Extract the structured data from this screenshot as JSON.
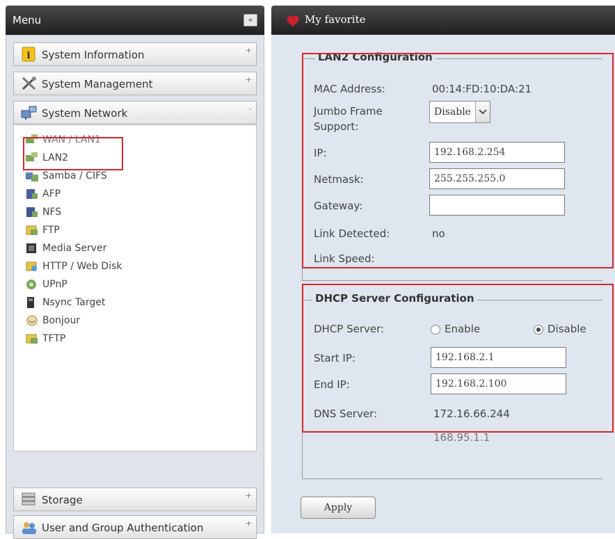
{
  "menu": {
    "title": "Menu",
    "collapse_glyph": "«",
    "categories": [
      {
        "label": "System Information",
        "icon": "info-icon",
        "toggle": "+"
      },
      {
        "label": "System Management",
        "icon": "tools-icon",
        "toggle": "+"
      },
      {
        "label": "System Network",
        "icon": "network-icon",
        "toggle": "-"
      }
    ],
    "network_items": [
      {
        "label": "WAN / LAN1"
      },
      {
        "label": "LAN2"
      },
      {
        "label": "Samba / CIFS"
      },
      {
        "label": "AFP"
      },
      {
        "label": "NFS"
      },
      {
        "label": "FTP"
      },
      {
        "label": "Media Server"
      },
      {
        "label": "HTTP / Web Disk"
      },
      {
        "label": "UPnP"
      },
      {
        "label": "Nsync Target"
      },
      {
        "label": "Bonjour"
      },
      {
        "label": "TFTP"
      }
    ],
    "bottom_categories": [
      {
        "label": "Storage",
        "icon": "storage-icon",
        "toggle": "+"
      },
      {
        "label": "User and Group Authentication",
        "icon": "users-icon",
        "toggle": "+"
      }
    ]
  },
  "favorite": {
    "title": "My favorite",
    "icon": "heart-icon"
  },
  "lan2": {
    "legend": "LAN2 Configuration",
    "mac_label": "MAC Address:",
    "mac_value": "00:14:FD:10:DA:21",
    "jumbo_label_1": "Jumbo Frame",
    "jumbo_label_2": "Support:",
    "jumbo_value": "Disable",
    "ip_label": "IP:",
    "ip_value": "192.168.2.254",
    "netmask_label": "Netmask:",
    "netmask_value": "255.255.255.0",
    "gateway_label": "Gateway:",
    "gateway_value": "",
    "link_detected_label": "Link Detected:",
    "link_detected_value": "no",
    "link_speed_label": "Link Speed:",
    "link_speed_value": ""
  },
  "dhcp": {
    "legend": "DHCP Server Configuration",
    "server_label": "DHCP Server:",
    "enable_label": "Enable",
    "disable_label": "Disable",
    "selected": "Disable",
    "start_label": "Start IP:",
    "start_value": "192.168.2.1",
    "end_label": "End IP:",
    "end_value": "192.168.2.100",
    "dns_label": "DNS Server:",
    "dns_values": [
      "172.16.66.244",
      "168.95.1.1"
    ]
  },
  "apply_label": "Apply",
  "colors": {
    "highlight": "#d6262c",
    "header": "#2a2a2a",
    "panel": "#dfe6ef"
  }
}
